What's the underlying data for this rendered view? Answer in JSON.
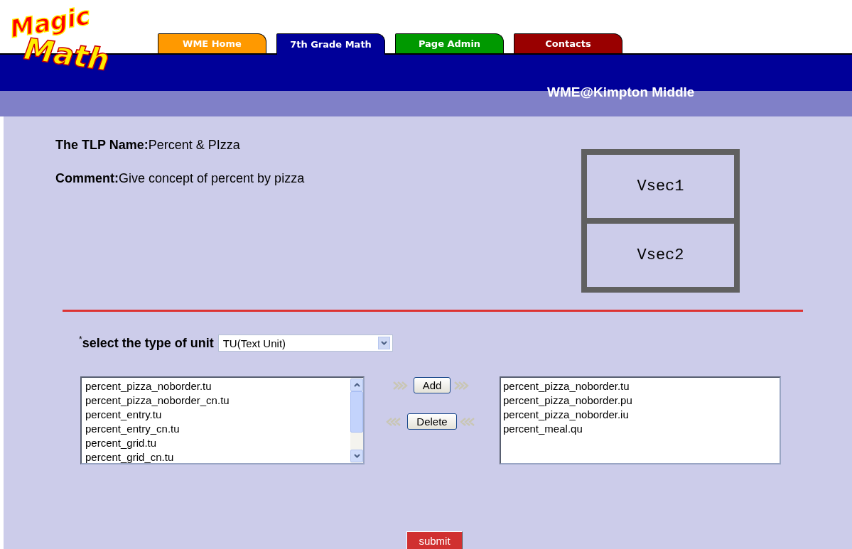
{
  "logo": {
    "line_1": "Magic",
    "line_2": "Math"
  },
  "tabs": [
    {
      "label": "WME Home",
      "selected": false,
      "color": "#ff9900"
    },
    {
      "label": "7th Grade Math",
      "selected": true,
      "color": "#000099"
    },
    {
      "label": "Page Admin",
      "selected": false,
      "color": "#009900"
    },
    {
      "label": "Contacts",
      "selected": false,
      "color": "#990000"
    }
  ],
  "site_name": "WME@Kimpton Middle",
  "tlp": {
    "name_label": "The TLP Name:",
    "name_value": "Percent & PIzza",
    "comment_label": "Comment:",
    "comment_value": "Give concept of percent by pizza"
  },
  "layout_preview": {
    "sections": [
      "Vsec1",
      "Vsec2"
    ]
  },
  "unit_type": {
    "required_mark": "*",
    "label": "select the type of unit",
    "value": "TU(Text Unit)"
  },
  "available_units": [
    "percent_pizza_noborder.tu",
    "percent_pizza_noborder_cn.tu",
    "percent_entry.tu",
    "percent_entry_cn.tu",
    "percent_grid.tu",
    "percent_grid_cn.tu"
  ],
  "add_button": "Add",
  "delete_button": "Delete",
  "selected_units": [
    "percent_pizza_noborder.tu",
    "percent_pizza_noborder.pu",
    "percent_pizza_noborder.iu",
    "percent_meal.qu"
  ],
  "submit_button": "submit"
}
